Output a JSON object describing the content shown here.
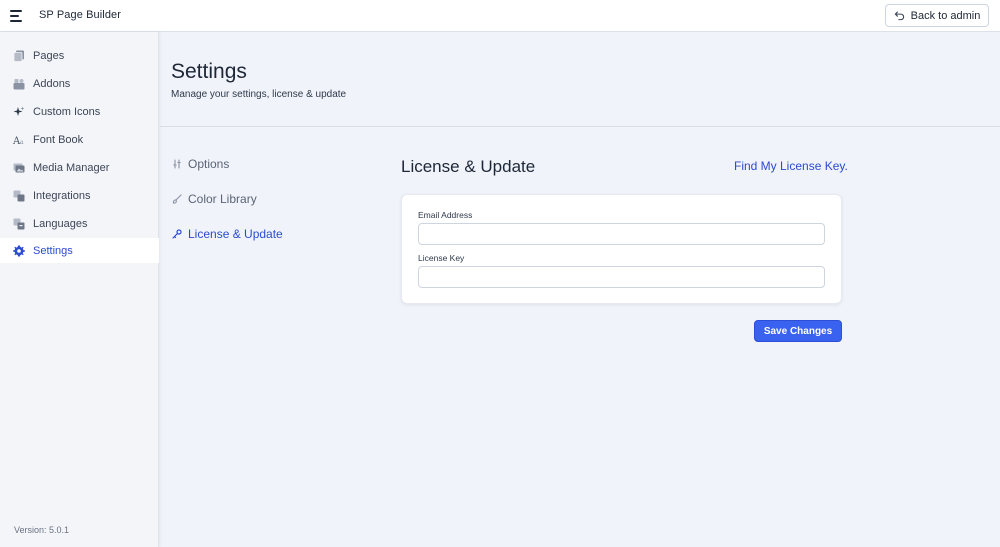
{
  "topbar": {
    "app_title": "SP Page Builder",
    "back_label": "Back to admin"
  },
  "sidebar": {
    "items": [
      {
        "label": "Pages",
        "icon": "pages-icon",
        "active": false
      },
      {
        "label": "Addons",
        "icon": "addons-icon",
        "active": false
      },
      {
        "label": "Custom Icons",
        "icon": "sparkle-icon",
        "active": false
      },
      {
        "label": "Font Book",
        "icon": "font-icon",
        "active": false
      },
      {
        "label": "Media Manager",
        "icon": "media-icon",
        "active": false
      },
      {
        "label": "Integrations",
        "icon": "integrations-icon",
        "active": false
      },
      {
        "label": "Languages",
        "icon": "languages-icon",
        "active": false
      },
      {
        "label": "Settings",
        "icon": "gear-icon",
        "active": true
      }
    ],
    "version": "Version: 5.0.1"
  },
  "header": {
    "title": "Settings",
    "subtitle": "Manage your settings, license & update"
  },
  "sub_nav": {
    "items": [
      {
        "label": "Options",
        "icon": "sliders-icon",
        "active": false
      },
      {
        "label": "Color Library",
        "icon": "brush-icon",
        "active": false
      },
      {
        "label": "License & Update",
        "icon": "key-icon",
        "active": true
      }
    ]
  },
  "license": {
    "title": "License & Update",
    "find_link": "Find My License Key.",
    "email_label": "Email Address",
    "email_value": "",
    "email_placeholder": "",
    "key_label": "License Key",
    "key_value": "",
    "key_placeholder": "",
    "save_label": "Save Changes"
  },
  "colors": {
    "accent": "#2b4bd1",
    "button": "#3a62f0",
    "background": "#f0f3fa"
  }
}
